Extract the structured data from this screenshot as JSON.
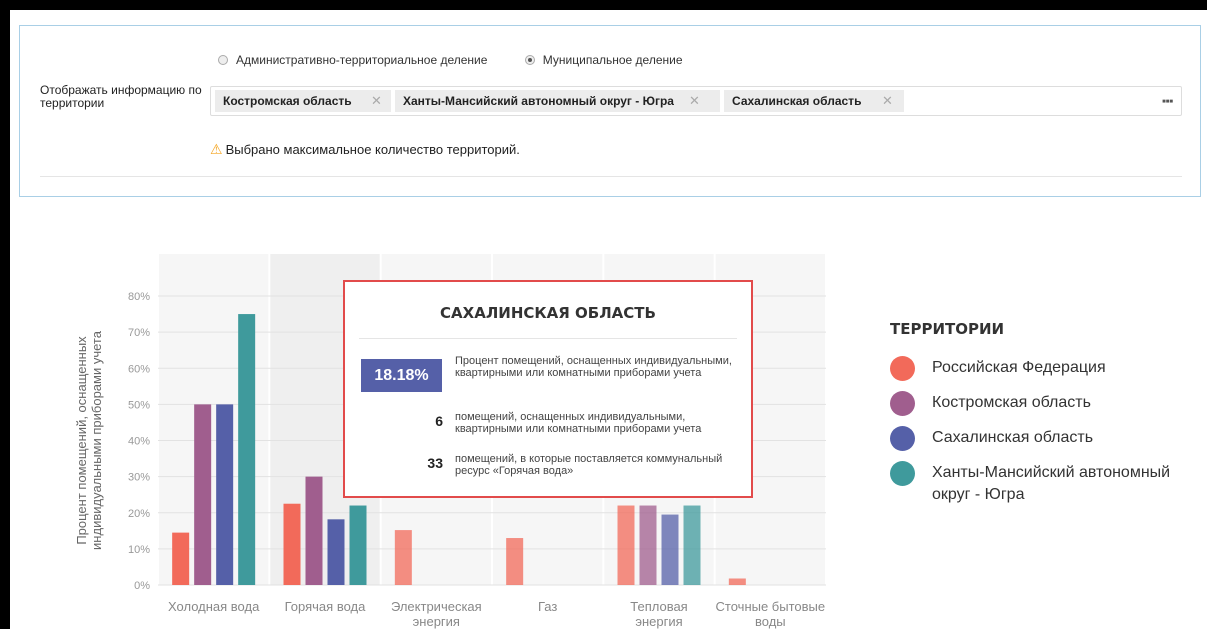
{
  "filter": {
    "radio_options": [
      {
        "label": "Административно-территориальное деление",
        "selected": false
      },
      {
        "label": "Муниципальное деление",
        "selected": true
      }
    ],
    "territory_label": "Отображать информацию по территории",
    "tags": [
      "Костромская область",
      "Ханты-Мансийский автономный округ - Югра",
      "Сахалинская область"
    ],
    "more_icon": "ellipsis-icon",
    "warning_icon": "warning-triangle-icon",
    "warning_text": "Выбрано максимальное количество территорий."
  },
  "chart_data": {
    "type": "bar",
    "ylabel": "Процент помещений, оснащенных индивидуальными приборами учета",
    "ylim": [
      0,
      80
    ],
    "yticks": [
      "0%",
      "10%",
      "20%",
      "30%",
      "40%",
      "50%",
      "60%",
      "70%",
      "80%"
    ],
    "categories": [
      "Холодная вода",
      "Горячая вода",
      "Электрическая энергия",
      "Газ",
      "Тепловая энергия",
      "Сточные бытовые воды"
    ],
    "series": [
      {
        "name": "Российская Федерация",
        "color": "#f26a5a",
        "values": [
          14.5,
          22.5,
          15.2,
          13.0,
          22.0,
          1.8
        ]
      },
      {
        "name": "Костромская область",
        "color": "#a05e8e",
        "values": [
          50,
          30,
          null,
          null,
          22.0,
          null
        ]
      },
      {
        "name": "Сахалинская область",
        "color": "#5560a8",
        "values": [
          50,
          18.18,
          null,
          null,
          19.5,
          null
        ]
      },
      {
        "name": "Ханты-Мансийский автономный округ - Югра",
        "color": "#3f9a9c",
        "values": [
          75,
          22.0,
          null,
          null,
          22.0,
          null
        ]
      }
    ],
    "highlighted_category": "Горячая вода",
    "legend_title": "ТЕРРИТОРИИ",
    "legend_placement": "right"
  },
  "tooltip": {
    "title": "САХАЛИНСКАЯ ОБЛАСТЬ",
    "percent": "18.18%",
    "percent_text": "Процент помещений, оснащенных индивидуальными, квартирными или комнатными приборами учета",
    "count_equipped": "6",
    "count_equipped_text": "помещений, оснащенных индивидуальными, квартирными или комнатными приборами учета",
    "count_supplied": "33",
    "count_supplied_text": "помещений, в которые поставляется коммунальный ресурс «Горячая вода»"
  }
}
